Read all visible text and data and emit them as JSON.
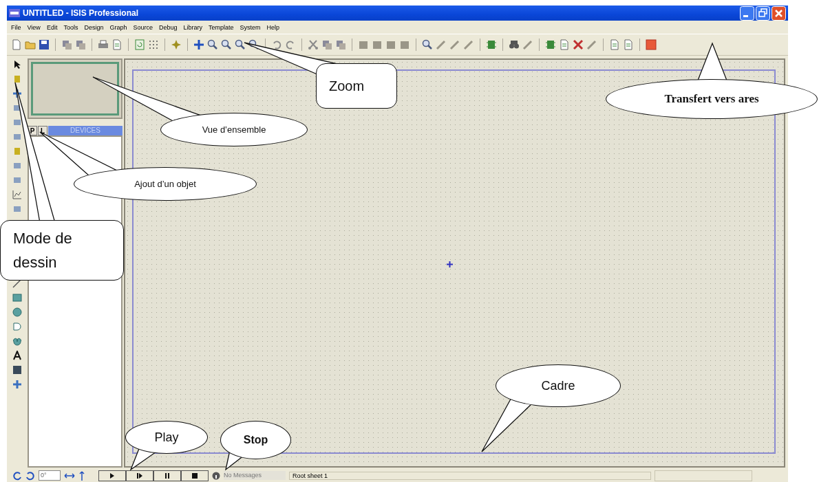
{
  "window": {
    "title": "UNTITLED - ISIS Professional"
  },
  "menu": [
    "File",
    "View",
    "Edit",
    "Tools",
    "Design",
    "Graph",
    "Source",
    "Debug",
    "Library",
    "Template",
    "System",
    "Help"
  ],
  "picker": {
    "buttons": [
      "P",
      "L"
    ],
    "header": "DEVICES"
  },
  "status_bar": {
    "angle": "0°",
    "messages": "No Messages",
    "sheet": "Root sheet 1"
  },
  "callouts": [
    {
      "text": "Zoom",
      "kind": "rounded",
      "bold": false
    },
    {
      "text": "Transfert vers ares",
      "kind": "ellipse",
      "bold": true
    },
    {
      "text": "Vue d’ensemble",
      "kind": "ellipse",
      "bold": false
    },
    {
      "text": "Ajout d’un objet",
      "kind": "ellipse",
      "bold": false
    },
    {
      "text": "Mode de dessin",
      "kind": "rounded",
      "bold": false
    },
    {
      "text": "Cadre",
      "kind": "ellipse",
      "bold": false
    },
    {
      "text": "Play",
      "kind": "ellipse",
      "bold": false
    },
    {
      "text": "Stop",
      "kind": "ellipse",
      "bold": true
    }
  ]
}
